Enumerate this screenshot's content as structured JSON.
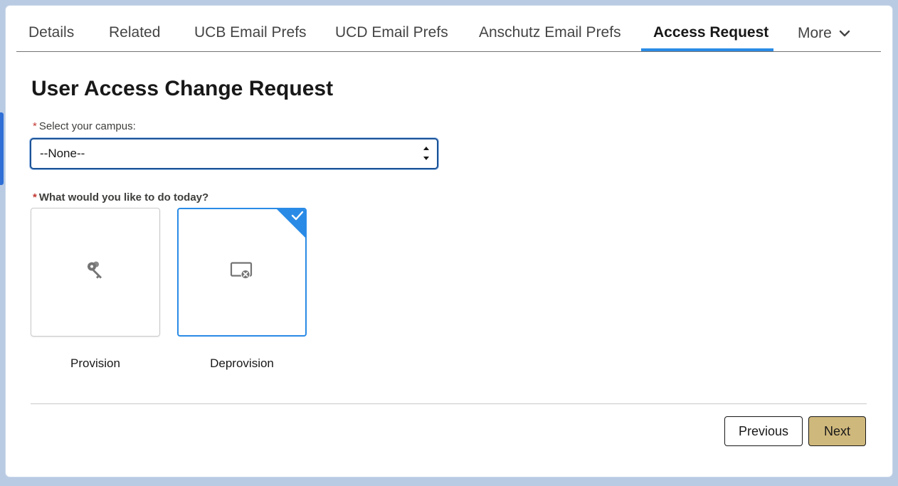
{
  "tabs": {
    "items": [
      {
        "label": "Details"
      },
      {
        "label": "Related"
      },
      {
        "label": "UCB Email Prefs"
      },
      {
        "label": "UCD Email Prefs"
      },
      {
        "label": "Anschutz Email Prefs"
      },
      {
        "label": "Access Request"
      }
    ],
    "active": "Access Request",
    "more_label": "More"
  },
  "page": {
    "title": "User Access Change Request"
  },
  "campus_field": {
    "required_mark": "*",
    "label": "Select your campus:",
    "value": "--None--"
  },
  "action_field": {
    "required_mark": "*",
    "label": "What would you like to do today?",
    "options": [
      {
        "label": "Provision",
        "icon": "key-icon",
        "selected": false
      },
      {
        "label": "Deprovision",
        "icon": "screen-remove-icon",
        "selected": true
      }
    ]
  },
  "footer": {
    "previous_label": "Previous",
    "next_label": "Next"
  },
  "colors": {
    "accent": "#2a8be6",
    "next_button": "#cfb87c",
    "required": "#c23934"
  }
}
